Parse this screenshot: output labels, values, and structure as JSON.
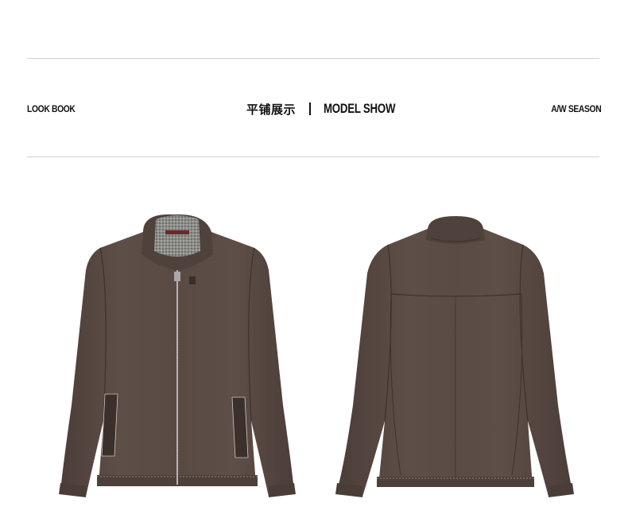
{
  "header": {
    "left_label": "LOOK BOOK",
    "center_cn": "平铺展示",
    "center_en": "MODEL SHOW",
    "right_label": "A/W SEASON"
  },
  "colors": {
    "leather": "#5a4a44",
    "leather_dark": "#473a35",
    "leather_light": "#6b5a53",
    "stitch": "#cfc6c0",
    "collar_lining": "#8a8a88",
    "rule": "#d0d0d0"
  },
  "images": [
    {
      "name": "jacket-front"
    },
    {
      "name": "jacket-back"
    }
  ]
}
